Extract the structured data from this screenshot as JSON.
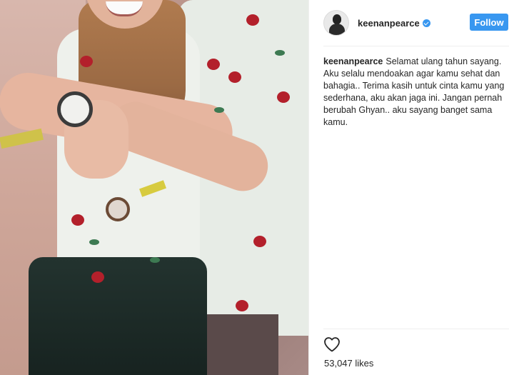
{
  "post": {
    "username": "keenanpearce",
    "verified": true,
    "follow_label": "Follow",
    "caption_user": "keenanpearce",
    "caption_text": "Selamat ulang tahun sayang. Aku selalu mendoakan agar kamu sehat dan bahagia.. Terima kasih untuk cinta kamu yang sederhana, aku akan jaga ini. Jangan pernah berubah Ghyan.. aku sayang banget sama kamu.",
    "likes": "53,047 likes"
  },
  "icons": {
    "like": "heart-outline-icon",
    "verified": "verified-badge-icon"
  },
  "colors": {
    "accent": "#3897f0",
    "text": "#262626",
    "divider": "#efefef"
  }
}
